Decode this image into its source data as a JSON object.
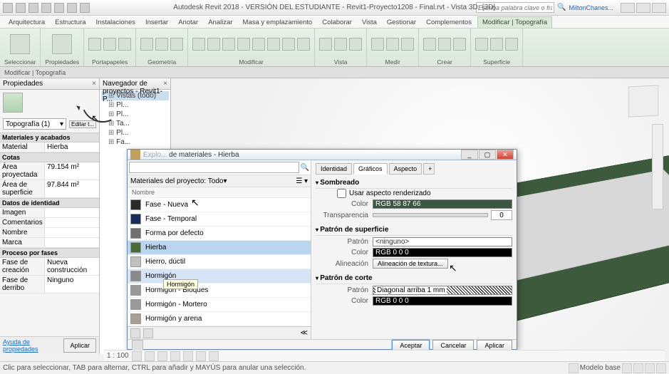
{
  "title": "Autodesk Revit 2018 - VERSIÓN DEL ESTUDIANTE -    Revit1-Proyecto1208 - Final.rvt - Vista 3D: {3D}",
  "search_placeholder": "Escriba palabra clave o frase",
  "user": "MiltonChanes...",
  "ribbon_tabs": [
    "Arquitectura",
    "Estructura",
    "Instalaciones",
    "Insertar",
    "Anotar",
    "Analizar",
    "Masa y emplazamiento",
    "Colaborar",
    "Vista",
    "Gestionar",
    "Complementos",
    "Modificar | Topografía"
  ],
  "ribbon_active_idx": 11,
  "ribbon_groups": [
    "Seleccionar",
    "Propiedades",
    "Portapapeles",
    "Geometría",
    "Modificar",
    "Vista",
    "Medir",
    "Crear",
    "Superficie"
  ],
  "subtab": "Modificar | Topografía",
  "properties": {
    "title": "Propiedades",
    "type_select": "Topografía (1)",
    "edit_btn": "Editar t...",
    "sections": [
      {
        "hdr": "Materiales y acabados",
        "rows": [
          {
            "k": "Material",
            "v": "Hierba"
          }
        ]
      },
      {
        "hdr": "Cotas",
        "rows": [
          {
            "k": "Área proyectada",
            "v": "79.154 m²"
          },
          {
            "k": "Área de superficie",
            "v": "97.844 m²"
          }
        ]
      },
      {
        "hdr": "Datos de identidad",
        "rows": [
          {
            "k": "Imagen",
            "v": ""
          },
          {
            "k": "Comentarios",
            "v": ""
          },
          {
            "k": "Nombre",
            "v": ""
          },
          {
            "k": "Marca",
            "v": ""
          }
        ]
      },
      {
        "hdr": "Proceso por fases",
        "rows": [
          {
            "k": "Fase de creación",
            "v": "Nueva construcción"
          },
          {
            "k": "Fase de derribo",
            "v": "Ninguno"
          }
        ]
      }
    ],
    "help": "Ayuda de propiedades",
    "apply": "Aplicar"
  },
  "browser": {
    "title": "Navegador de proyectos - Revit1-P...",
    "root": "Vistas (todo)",
    "items": [
      "Pl...",
      "Pl...",
      "Ta...",
      "Pl...",
      "Fa..."
    ]
  },
  "dialog": {
    "title": "de materiales - Hierba",
    "filter": "Materiales del proyecto: Todo",
    "name_hdr": "Nombre",
    "materials": [
      {
        "label": "Fase - Nueva",
        "sw": "#2a2a2a"
      },
      {
        "label": "Fase - Temporal",
        "sw": "#1a2a5a"
      },
      {
        "label": "Forma por defecto",
        "sw": "#707070"
      },
      {
        "label": "Hierba",
        "sw": "#4a6a3a",
        "sel": true
      },
      {
        "label": "Hierro, dúctil",
        "sw": "#c0c0c0"
      },
      {
        "label": "Hormigón",
        "sw": "#8a8a8a",
        "hov": true,
        "tooltip": "Hormigón"
      },
      {
        "label": "Hormigón - Bloques",
        "sw": "#999"
      },
      {
        "label": "Hormigón - Mortero",
        "sw": "#9a9a9a"
      },
      {
        "label": "Hormigón y arena",
        "sw": "#a5a090"
      }
    ],
    "tabs": [
      "Identidad",
      "Gráficos",
      "Aspecto"
    ],
    "tabs_active": 1,
    "shading": {
      "hdr": "Sombreado",
      "use_render": "Usar aspecto renderizado",
      "color_lbl": "Color",
      "color_val": "RGB 58 87 66",
      "color_hex": "#3a5742",
      "transp_lbl": "Transparencia",
      "transp_val": "0"
    },
    "surf": {
      "hdr": "Patrón de superficie",
      "pat_lbl": "Patrón",
      "pat_val": "<ninguno>",
      "color_lbl": "Color",
      "color_val": "RGB 0 0 0",
      "align_lbl": "Alineación",
      "align_val": "Alineación de textura..."
    },
    "cut": {
      "hdr": "Patrón de corte",
      "pat_lbl": "Patrón",
      "pat_val": "Diagonal arriba 1 mm",
      "color_lbl": "Color",
      "color_val": "RGB 0 0 0"
    },
    "buttons": {
      "ok": "Aceptar",
      "cancel": "Cancelar",
      "apply": "Aplicar"
    }
  },
  "viewctrl": {
    "scale": "1 : 100"
  },
  "status": {
    "hint": "Clic para seleccionar, TAB para alternar, CTRL para añadir y MAYÚS para anular una selección.",
    "model": "Modelo base"
  }
}
